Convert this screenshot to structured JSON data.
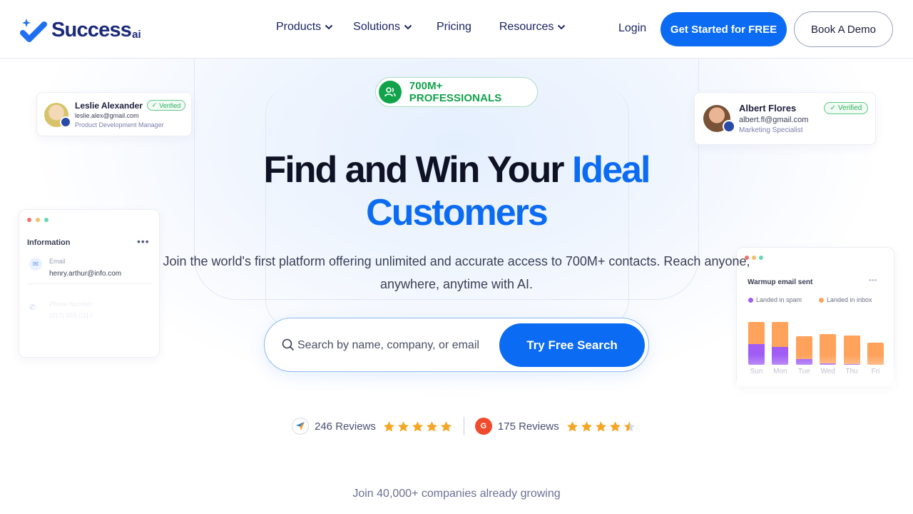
{
  "brand": {
    "name": "Success",
    "suffix": "ai",
    "primary_color": "#0b6bf2",
    "navy_color": "#1b2a7a",
    "green_color": "#10a34a"
  },
  "nav": {
    "items": [
      {
        "label": "Products",
        "has_dropdown": true
      },
      {
        "label": "Solutions",
        "has_dropdown": true
      },
      {
        "label": "Pricing",
        "has_dropdown": false
      },
      {
        "label": "Resources",
        "has_dropdown": true
      }
    ],
    "login": "Login",
    "cta_primary": "Get Started for FREE",
    "cta_secondary": "Book A Demo"
  },
  "hero": {
    "badge": "700M+ PROFESSIONALS",
    "title_line1_plain": "Find and Win Your",
    "title_line1_accent": "Ideal",
    "title_line2_accent": "Customers",
    "subtitle": "Join the world's first platform offering unlimited and accurate access to 700M+ contacts. Reach anyone, anywhere, anytime with AI.",
    "search_placeholder": "Search by name, company, or email",
    "search_button": "Try Free Search"
  },
  "reviews": [
    {
      "platform_icon": "capterra-icon",
      "count_label": "246 Reviews",
      "rating": 5
    },
    {
      "platform_icon": "g2-icon",
      "count_label": "175 Reviews",
      "rating": 4.5
    }
  ],
  "companies_text": "Join 40,000+ companies already growing",
  "profile_cards": [
    {
      "name": "Leslie Alexander",
      "email": "leslie.alex@gmail.com",
      "role": "Product Development Manager",
      "status": "Verified"
    },
    {
      "name": "Albert Flores",
      "email": "albert.fl@gmail.com",
      "role": "Marketing Specialist",
      "status": "Verified"
    }
  ],
  "info_card": {
    "title": "Information",
    "email_label": "Email",
    "email_value": "henry.arthur@info.com",
    "phone_label": "Phone Number",
    "phone_value": "(217) 555-0113"
  },
  "warmup_card": {
    "title": "Warmup email sent",
    "legend": [
      {
        "label": "Landed in spam",
        "color": "#a05cf5"
      },
      {
        "label": "Landed in inbox",
        "color": "#ffa25b"
      }
    ]
  },
  "chart_data": {
    "type": "bar",
    "stacked": true,
    "categories": [
      "Sun",
      "Mon",
      "Tue",
      "Wed",
      "Thu",
      "Fri"
    ],
    "series": [
      {
        "name": "Landed in spam",
        "values": [
          28,
          24,
          8,
          2,
          1,
          0
        ]
      },
      {
        "name": "Landed in inbox",
        "values": [
          30,
          34,
          31,
          40,
          39,
          30
        ]
      }
    ],
    "ylim": [
      0,
      60
    ],
    "grid": false,
    "legend_position": "top-left"
  }
}
